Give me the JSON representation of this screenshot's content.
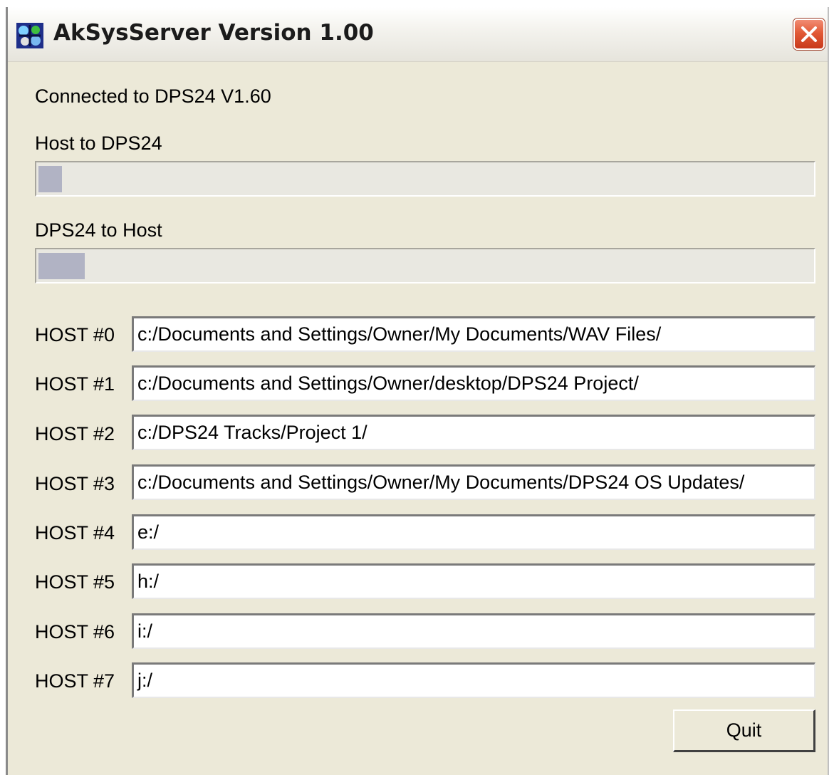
{
  "window": {
    "title": "AkSysServer Version 1.00",
    "app_icon": "aksys-app-icon",
    "close_icon": "close-icon"
  },
  "status": {
    "connection": "Connected to DPS24 V1.60"
  },
  "transfers": {
    "host_to_dps24_label": "Host to DPS24",
    "host_to_dps24_progress": 0.03,
    "dps24_to_host_label": "DPS24 to Host",
    "dps24_to_host_progress": 0.06
  },
  "hosts": [
    {
      "label": "HOST #0",
      "path": "c:/Documents and Settings/Owner/My Documents/WAV Files/"
    },
    {
      "label": "HOST #1",
      "path": "c:/Documents and Settings/Owner/desktop/DPS24 Project/"
    },
    {
      "label": "HOST #2",
      "path": "c:/DPS24 Tracks/Project 1/"
    },
    {
      "label": "HOST #3",
      "path": "c:/Documents and Settings/Owner/My Documents/DPS24 OS Updates/"
    },
    {
      "label": "HOST #4",
      "path": "e:/"
    },
    {
      "label": "HOST #5",
      "path": "h:/"
    },
    {
      "label": "HOST #6",
      "path": "i:/"
    },
    {
      "label": "HOST #7",
      "path": "j:/"
    }
  ],
  "buttons": {
    "quit_label": "Quit"
  },
  "colors": {
    "window_bg": "#ece9d8",
    "progress_fill": "#b1b3c4",
    "close_button": "#e25a37"
  }
}
